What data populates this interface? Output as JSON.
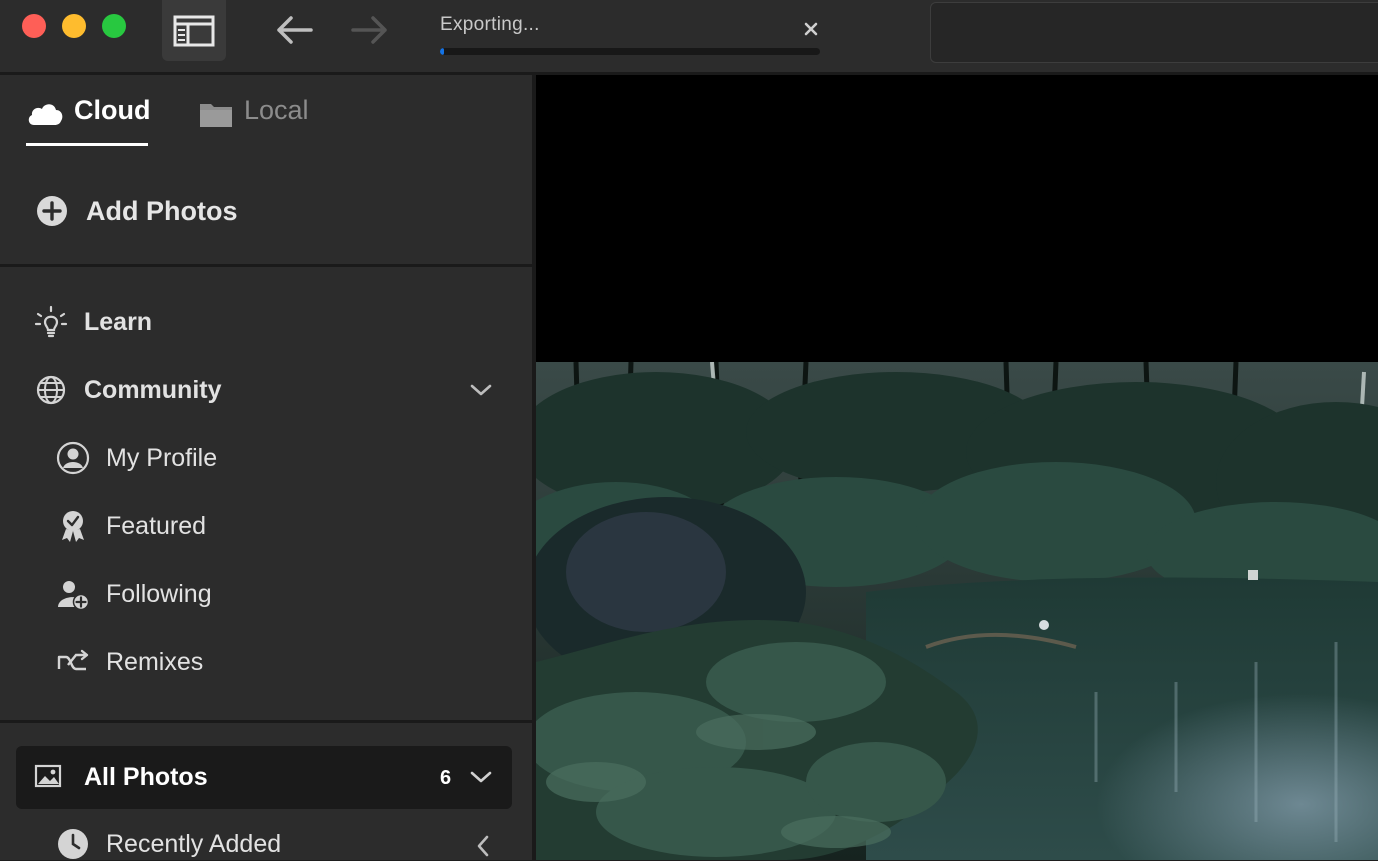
{
  "titlebar": {
    "export": {
      "label": "Exporting...",
      "progress_fraction": 0.01
    }
  },
  "sidebar": {
    "tabs": [
      {
        "label": "Cloud",
        "icon": "cloud-icon",
        "active": true
      },
      {
        "label": "Local",
        "icon": "folder-icon",
        "active": false
      }
    ],
    "add_photos_label": "Add Photos",
    "learn_label": "Learn",
    "community": {
      "label": "Community",
      "items": [
        {
          "label": "My Profile",
          "icon": "profile-icon"
        },
        {
          "label": "Featured",
          "icon": "award-icon"
        },
        {
          "label": "Following",
          "icon": "user-add-icon"
        },
        {
          "label": "Remixes",
          "icon": "remix-icon"
        }
      ]
    },
    "all_photos": {
      "label": "All Photos",
      "count": "6"
    },
    "recently_added_label": "Recently Added"
  },
  "colors": {
    "accent": "#1473e6",
    "panel_bg": "#2c2c2c",
    "close_red": "#fe5f57",
    "min_yellow": "#febc2e",
    "max_green": "#28c840"
  }
}
